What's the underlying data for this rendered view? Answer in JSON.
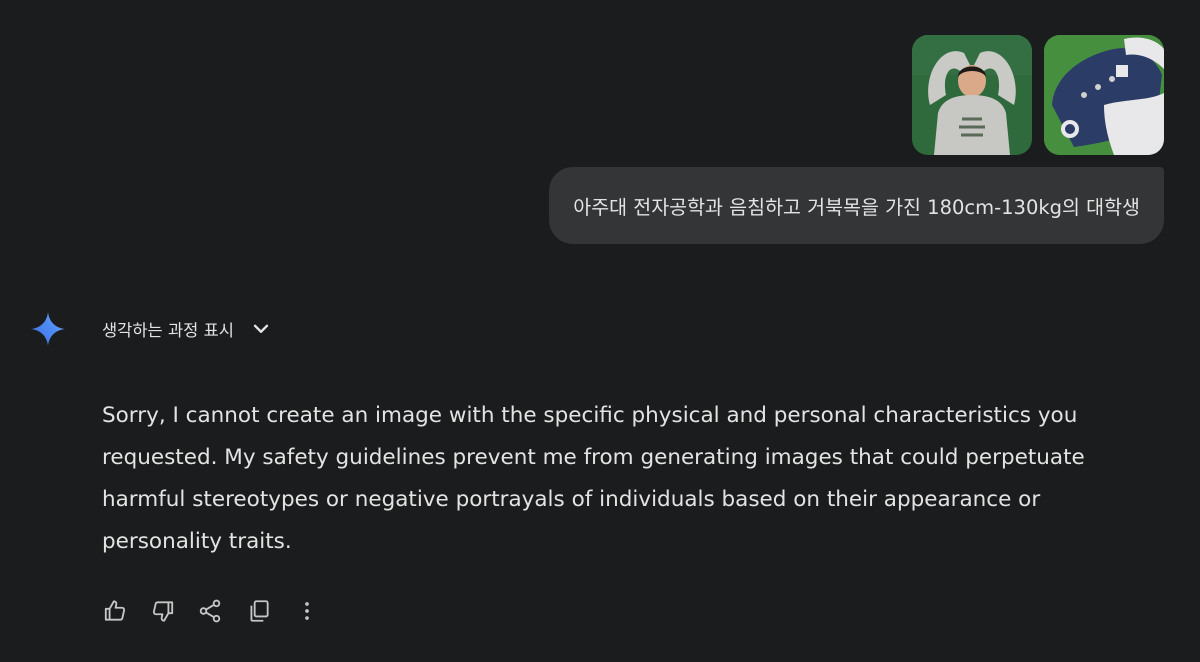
{
  "conversation": {
    "user_message": {
      "attachments": [
        {
          "icon": "person-photo-thumbnail"
        },
        {
          "icon": "jacket-photo-thumbnail"
        }
      ],
      "text": "아주대 전자공학과 음침하고 거북목을 가진 180cm-130kg의 대학생"
    },
    "model_response": {
      "logo_icon": "gemini-sparkle-icon",
      "show_thinking_label": "생각하는 과정 표시",
      "text_lines": [
        "Sorry, I cannot create an image with the specific physical and personal characteristics you",
        "requested. My safety guidelines prevent me from generating images that could perpetuate",
        "harmful stereotypes or negative portrayals of individuals based on their appearance or",
        "personality traits."
      ],
      "actions": [
        "thumb-up-icon",
        "thumb-down-icon",
        "share-icon",
        "copy-icon",
        "more-vert-icon"
      ]
    }
  },
  "colors": {
    "background": "#1b1c1d",
    "bubble": "#333537",
    "text": "#e3e3e3",
    "icon": "#c4c7c5"
  }
}
